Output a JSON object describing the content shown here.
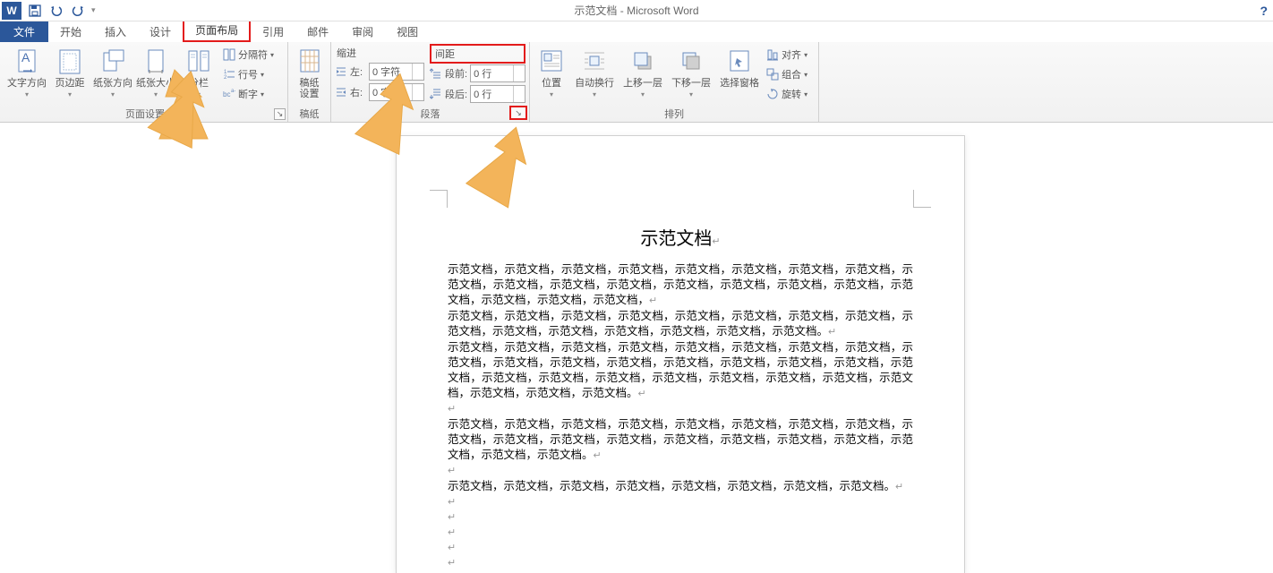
{
  "title": "示范文档 - Microsoft Word",
  "qat": {
    "save": "保存",
    "undo": "撤销",
    "redo": "重做"
  },
  "tabs": {
    "file": "文件",
    "home": "开始",
    "insert": "插入",
    "design": "设计",
    "pagelayout": "页面布局",
    "references": "引用",
    "mailings": "邮件",
    "review": "审阅",
    "view": "视图"
  },
  "ribbon": {
    "page_setup": {
      "text_direction": "文字方向",
      "margins": "页边距",
      "orientation": "纸张方向",
      "size": "纸张大小",
      "columns": "分栏",
      "breaks": "分隔符",
      "line_numbers": "行号",
      "hyphenation": "断字",
      "group": "页面设置"
    },
    "manuscript": {
      "btn": "稿纸\n设置",
      "group": "稿纸"
    },
    "paragraph": {
      "indent_label": "缩进",
      "spacing_label": "间距",
      "left": "左:",
      "right": "右:",
      "before": "段前:",
      "after": "段后:",
      "left_val": "0 字符",
      "right_val": "0 字符",
      "before_val": "0 行",
      "after_val": "0 行",
      "group": "段落"
    },
    "arrange": {
      "position": "位置",
      "wrap": "自动换行",
      "bring": "上移一层",
      "send": "下移一层",
      "selection": "选择窗格",
      "align": "对齐",
      "group_obj": "组合",
      "rotate": "旋转",
      "group": "排列"
    }
  },
  "document": {
    "heading": "示范文档",
    "run": "示范文档，",
    "run_end": "示范文档。",
    "p1_count": 19,
    "p2_count": 14,
    "p3_count": 27,
    "p4_count": 18,
    "p5_count": 7
  }
}
